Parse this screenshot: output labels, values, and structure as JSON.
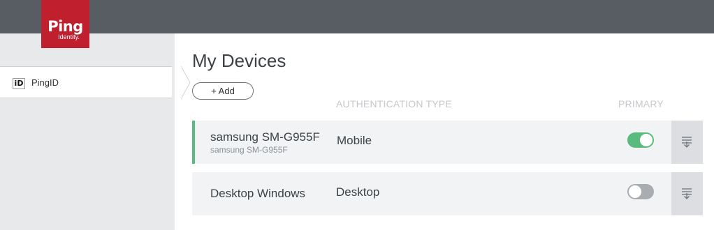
{
  "header": {
    "logo": {
      "brand": "Ping",
      "sub": "Identity."
    }
  },
  "sidebar": {
    "items": [
      {
        "icon": "iD",
        "label": "PingID"
      }
    ]
  },
  "main": {
    "title": "My Devices",
    "add_label": "+ Add",
    "columns": {
      "auth_type": "AUTHENTICATION TYPE",
      "primary": "PRIMARY"
    },
    "devices": [
      {
        "name": "samsung SM-G955F",
        "model": "samsung SM-G955F",
        "type": "Mobile",
        "primary": true
      },
      {
        "name": "Desktop Windows",
        "type": "Desktop",
        "primary": false
      }
    ]
  },
  "colors": {
    "brand": "#c0202d",
    "topbar": "#585d63",
    "accent": "#5bba7e"
  }
}
